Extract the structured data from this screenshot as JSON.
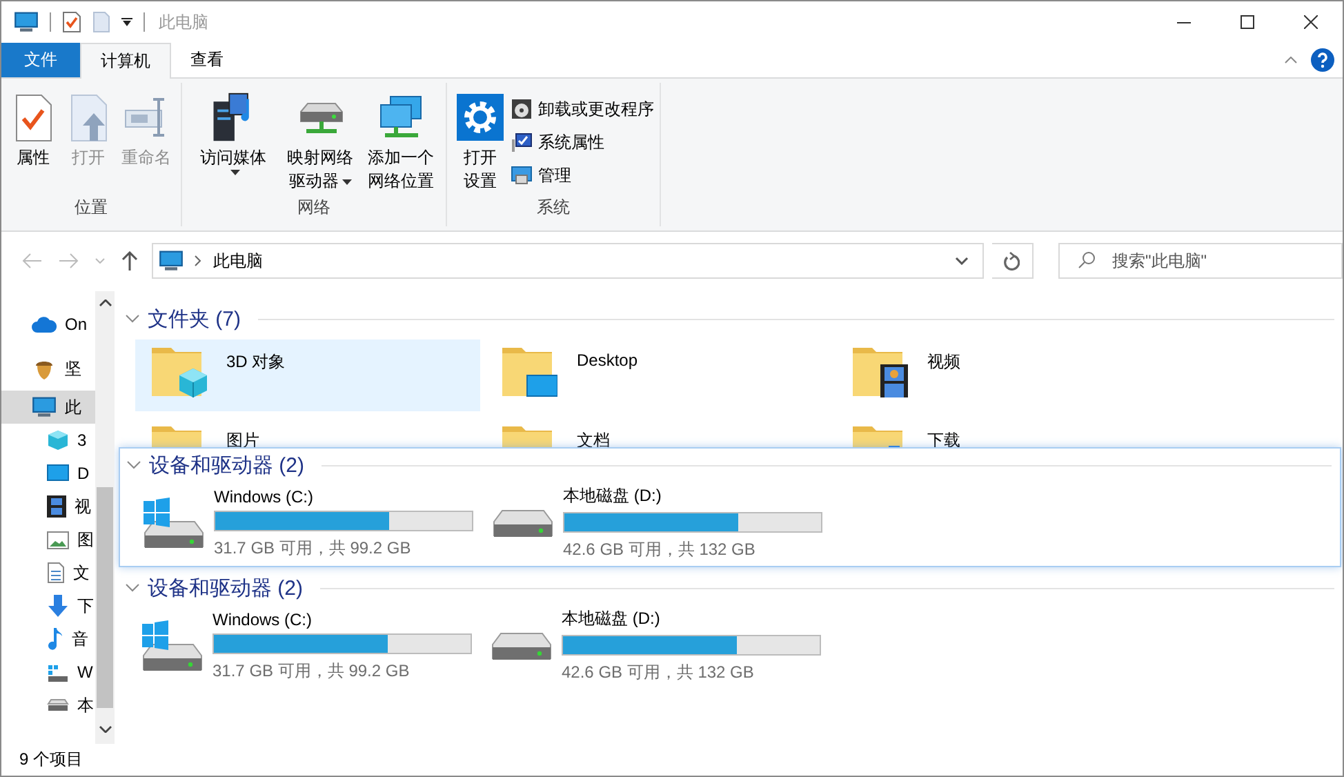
{
  "window": {
    "title": "此电脑"
  },
  "ribbon_tabs": [
    {
      "label": "文件",
      "kind": "menu",
      "selected": false
    },
    {
      "label": "计算机",
      "kind": "tab",
      "selected": true
    },
    {
      "label": "查看",
      "kind": "tab",
      "selected": false
    }
  ],
  "ribbon_groups": [
    {
      "label": "位置",
      "buttons": [
        {
          "label": "属性",
          "disabled": false
        },
        {
          "label": "打开",
          "disabled": true
        },
        {
          "label": "重命名",
          "disabled": true
        }
      ]
    },
    {
      "label": "网络",
      "buttons": [
        {
          "label": "访问媒体",
          "disabled": false,
          "dropdown": true
        },
        {
          "label": "映射网络驱动器",
          "disabled": false,
          "dropdown": true
        },
        {
          "label": "添加一个网络位置",
          "disabled": false
        }
      ]
    },
    {
      "label": "系统",
      "buttons": [
        {
          "label": "打开设置",
          "disabled": false
        }
      ],
      "small_buttons": [
        "卸载或更改程序",
        "系统属性",
        "管理"
      ]
    }
  ],
  "address_bar": {
    "path": "此电脑"
  },
  "search": {
    "placeholder": "搜索\"此电脑\""
  },
  "sidebar": {
    "items": [
      {
        "label": "On",
        "selected": false
      },
      {
        "label": "坚",
        "selected": false
      },
      {
        "label": "此",
        "selected": true,
        "children": [
          {
            "label": "3",
            "selected": false
          },
          {
            "label": "D",
            "selected": false
          },
          {
            "label": "视",
            "selected": false
          },
          {
            "label": "图",
            "selected": false
          },
          {
            "label": "文",
            "selected": false
          },
          {
            "label": "下",
            "selected": false
          },
          {
            "label": "音",
            "selected": false
          },
          {
            "label": "W",
            "selected": false
          },
          {
            "label": "本",
            "selected": false
          }
        ]
      }
    ]
  },
  "folders": {
    "header": "文件夹 (7)",
    "items": [
      {
        "label": "3D 对象",
        "kind": "objects",
        "selected": true
      },
      {
        "label": "Desktop",
        "kind": "desktop",
        "selected": false
      },
      {
        "label": "视频",
        "kind": "videos",
        "selected": false
      },
      {
        "label": "图片",
        "kind": "pictures",
        "selected": false
      },
      {
        "label": "文档",
        "kind": "documents",
        "selected": false
      },
      {
        "label": "下载",
        "kind": "downloads",
        "selected": false
      }
    ]
  },
  "drives": {
    "header": "设备和驱动器 (2)",
    "items": [
      {
        "name": "Windows (C:)",
        "kind": "system",
        "level": 0.68,
        "space": "31.7 GB 可用，共 99.2 GB"
      },
      {
        "name": "本地磁盘 (D:)",
        "kind": "local",
        "level": 0.677,
        "space": "42.6 GB 可用，共 132 GB"
      }
    ]
  },
  "dragged_section": {
    "header": "设备和驱动器 (2)",
    "items": [
      {
        "name": "Windows (C:)",
        "kind": "system",
        "level": 0.68,
        "space": "31.7 GB 可用，共 99.2 GB"
      },
      {
        "name": "本地磁盘 (D:)",
        "kind": "local",
        "level": 0.677,
        "space": "42.6 GB 可用，共 132 GB"
      }
    ]
  },
  "status_bar": {
    "item_count": "9 个项目"
  }
}
